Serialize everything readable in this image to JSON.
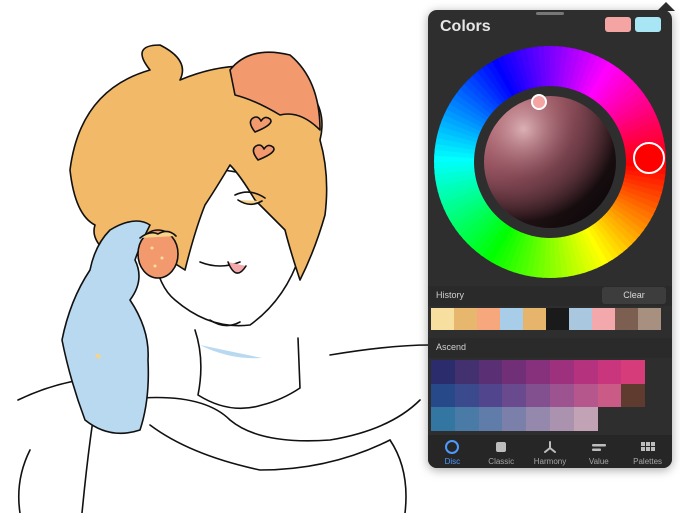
{
  "panel": {
    "title": "Colors",
    "primary_color": "#f5a4a4",
    "secondary_color": "#a8e6f5"
  },
  "history": {
    "label": "History",
    "clear_label": "Clear",
    "swatches": [
      "#f7dfa0",
      "#e8b76e",
      "#f6a77c",
      "#a8cde8",
      "#e6b46a",
      "#1a1a1a",
      "#a9c8e0",
      "#f3a8ac",
      "#7d5f51",
      "#a89080"
    ]
  },
  "palette": {
    "name": "Ascend",
    "swatches": [
      "#2a2c6b",
      "#43306f",
      "#5a2f74",
      "#712f78",
      "#87307b",
      "#9e317d",
      "#b4327e",
      "#c9367d",
      "#d63c7a",
      "#2e2e2e",
      "#27498a",
      "#3a4a8c",
      "#51468d",
      "#6a4a8f",
      "#83508f",
      "#9c538f",
      "#b5568c",
      "#ca5a86",
      "#5f3a2e",
      "#2e2e2e",
      "#3476a2",
      "#4a7aa6",
      "#607ca8",
      "#7a80aa",
      "#9588ad",
      "#ab93b0",
      "#c2a3b6",
      "#2e2e2e",
      "#2e2e2e",
      "#2e2e2e"
    ]
  },
  "tabs": [
    {
      "label": "Disc",
      "icon": "disc-icon",
      "active": true
    },
    {
      "label": "Classic",
      "icon": "classic-square-icon",
      "active": false
    },
    {
      "label": "Harmony",
      "icon": "harmony-icon",
      "active": false
    },
    {
      "label": "Value",
      "icon": "value-sliders-icon",
      "active": false
    },
    {
      "label": "Palettes",
      "icon": "palettes-grid-icon",
      "active": false
    }
  ],
  "accent_color": "#4d9aff"
}
